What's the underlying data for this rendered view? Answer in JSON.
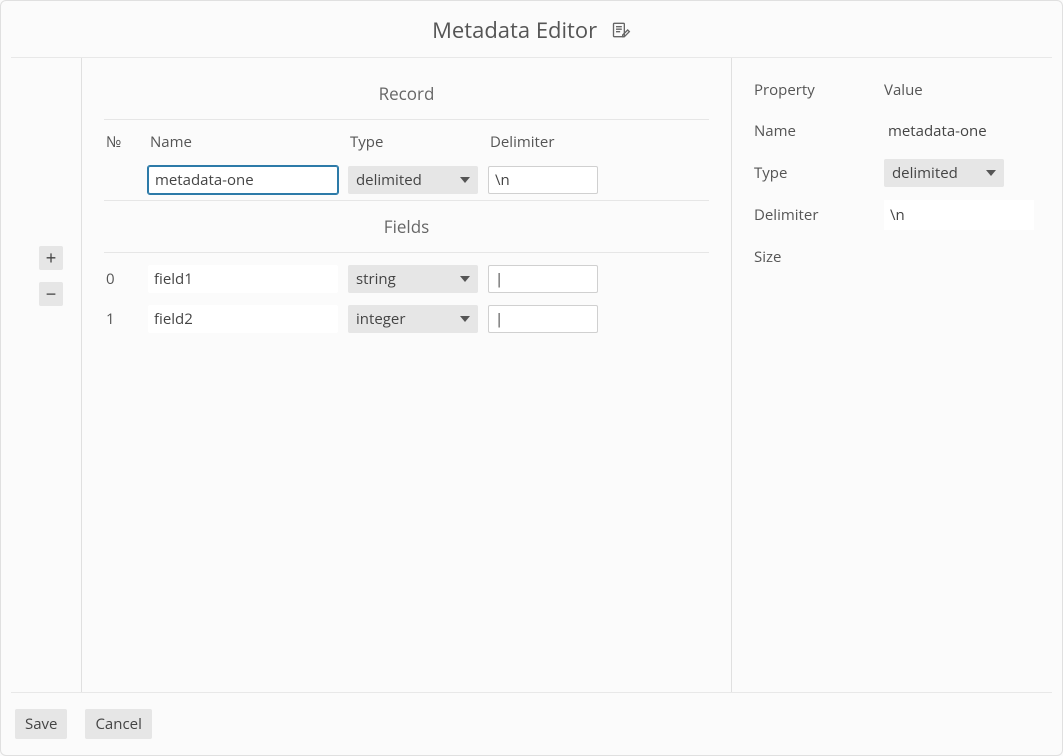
{
  "title": "Metadata Editor",
  "sections": {
    "record": "Record",
    "fields": "Fields"
  },
  "columns": {
    "index": "№",
    "name": "Name",
    "type": "Type",
    "delimiter": "Delimiter"
  },
  "record": {
    "name": "metadata-one",
    "type": "delimited",
    "delimiter": "\\n"
  },
  "fields": [
    {
      "index": "0",
      "name": "field1",
      "type": "string",
      "delimiter": "|"
    },
    {
      "index": "1",
      "name": "field2",
      "type": "integer",
      "delimiter": "|"
    }
  ],
  "properties": {
    "header_property": "Property",
    "header_value": "Value",
    "rows": {
      "name": {
        "label": "Name",
        "value": "metadata-one"
      },
      "type": {
        "label": "Type",
        "value": "delimited"
      },
      "delimiter": {
        "label": "Delimiter",
        "value": "\\n"
      },
      "size": {
        "label": "Size",
        "value": ""
      }
    }
  },
  "buttons": {
    "save": "Save",
    "cancel": "Cancel"
  },
  "icons": {
    "plus": "+",
    "minus": "−"
  }
}
